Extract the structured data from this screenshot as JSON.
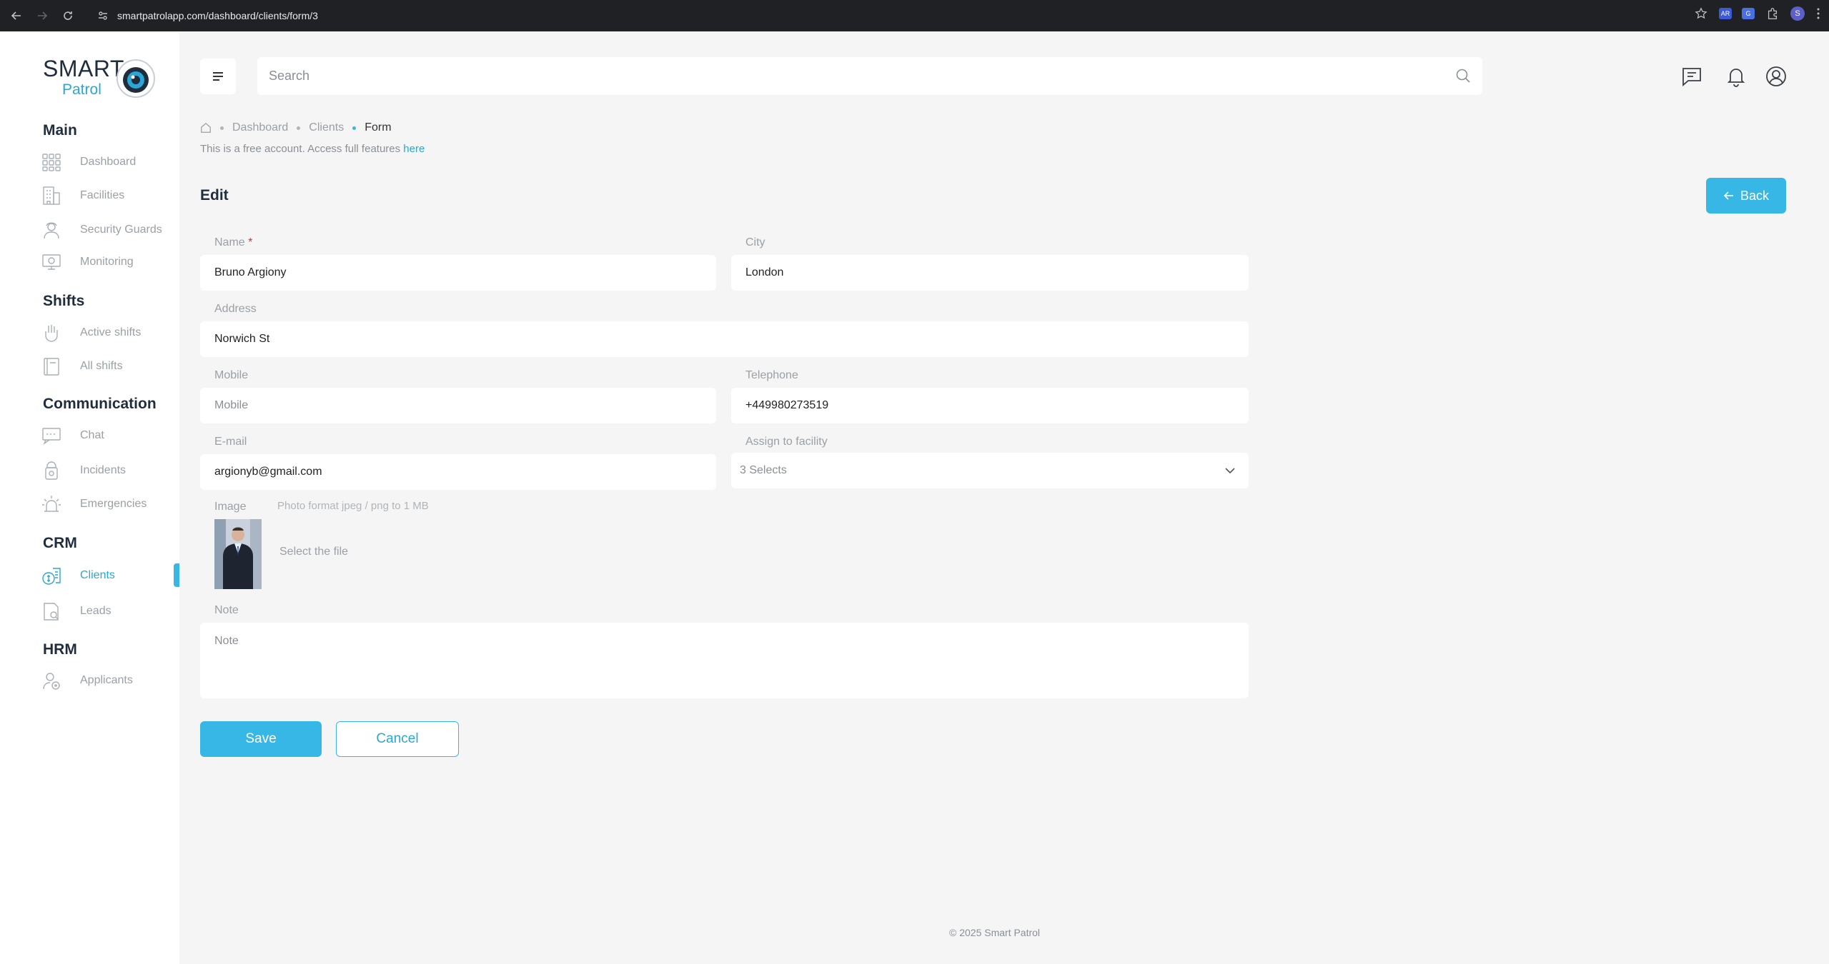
{
  "browser": {
    "url": "smartpatrolapp.com/dashboard/clients/form/3",
    "profile_initial": "S",
    "ext1_label": "AR",
    "ext2_label": "G"
  },
  "brand": {
    "line1": "SMART",
    "line2": "Patrol"
  },
  "sidebar": {
    "sections": [
      {
        "title": "Main",
        "items": [
          {
            "label": "Dashboard",
            "icon": "grid-icon"
          },
          {
            "label": "Facilities",
            "icon": "building-icon"
          },
          {
            "label": "Security Guards",
            "icon": "guard-icon"
          },
          {
            "label": "Monitoring",
            "icon": "monitor-icon"
          }
        ]
      },
      {
        "title": "Shifts",
        "items": [
          {
            "label": "Active shifts",
            "icon": "hand-icon"
          },
          {
            "label": "All shifts",
            "icon": "calendar-icon"
          }
        ]
      },
      {
        "title": "Communication",
        "items": [
          {
            "label": "Chat",
            "icon": "chat-icon"
          },
          {
            "label": "Incidents",
            "icon": "incident-icon"
          },
          {
            "label": "Emergencies",
            "icon": "siren-icon"
          }
        ]
      },
      {
        "title": "CRM",
        "items": [
          {
            "label": "Clients",
            "icon": "clients-icon",
            "active": true
          },
          {
            "label": "Leads",
            "icon": "leads-icon"
          }
        ]
      },
      {
        "title": "HRM",
        "items": [
          {
            "label": "Applicants",
            "icon": "applicants-icon"
          }
        ]
      }
    ]
  },
  "search": {
    "placeholder": "Search"
  },
  "breadcrumb": {
    "items": [
      "Dashboard",
      "Clients"
    ],
    "current": "Form"
  },
  "notice": {
    "text": "This is a free account. Access full features ",
    "link": "here"
  },
  "page": {
    "title": "Edit",
    "back_label": "Back"
  },
  "form": {
    "name": {
      "label": "Name",
      "required": "*",
      "value": "Bruno Argiony"
    },
    "city": {
      "label": "City",
      "value": "London"
    },
    "address": {
      "label": "Address",
      "value": "Norwich St"
    },
    "mobile": {
      "label": "Mobile",
      "placeholder": "Mobile"
    },
    "telephone": {
      "label": "Telephone",
      "value": "+449980273519"
    },
    "email": {
      "label": "E-mail",
      "value": "argionyb@gmail.com"
    },
    "facility": {
      "label": "Assign to facility",
      "value": "3 Selects"
    },
    "image": {
      "label": "Image",
      "hint": "Photo format jpeg / png to 1 MB",
      "select_label": "Select the file"
    },
    "note": {
      "label": "Note",
      "placeholder": "Note"
    },
    "save_label": "Save",
    "cancel_label": "Cancel"
  },
  "footer": {
    "text": "© 2025 Smart Patrol"
  },
  "colors": {
    "accent": "#36b7e5",
    "sidebar_bg": "#ffffff",
    "page_bg": "#f5f5f5",
    "chrome_bg": "#202124"
  }
}
